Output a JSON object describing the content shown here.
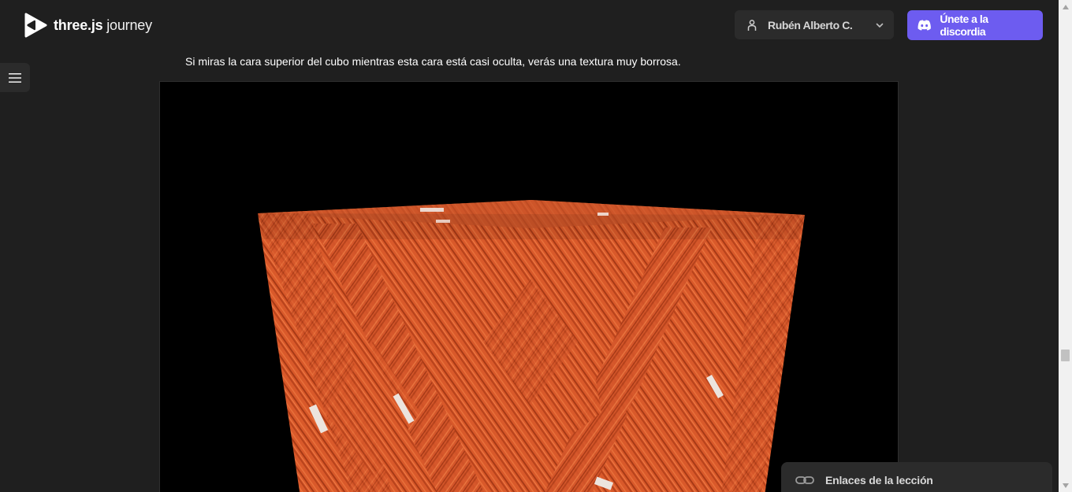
{
  "header": {
    "logo_bold": "three.js",
    "logo_light": " journey",
    "user_name": "Rubén Alberto C.",
    "discord_label": "Únete a la discordia"
  },
  "content": {
    "paragraph": "Si miras la cara superior del cubo mientras esta cara está casi oculta, verás una textura muy borrosa."
  },
  "footer": {
    "lesson_links_label": "Enlaces de la lección"
  },
  "colors": {
    "background": "#1f1f1f",
    "panel": "#2b2b2b",
    "accent": "#6d5cf0",
    "wood": "#d9592a"
  },
  "icons": {
    "logo": "threejs-logo-icon",
    "user": "user-icon",
    "chevron": "chevron-down-icon",
    "discord": "discord-icon",
    "menu": "hamburger-icon",
    "link": "link-icon"
  }
}
